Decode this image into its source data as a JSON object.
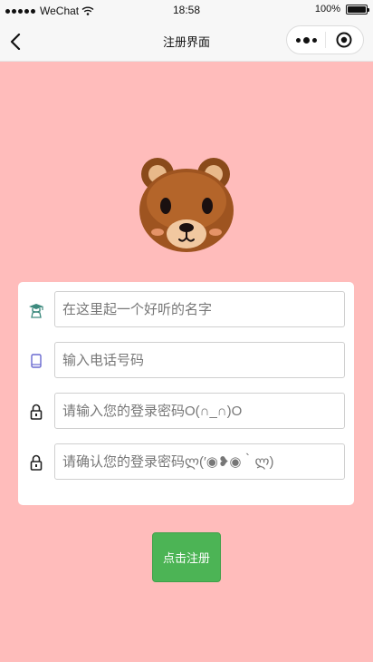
{
  "status_bar": {
    "carrier": "WeChat",
    "time": "18:58",
    "battery_text": "100%",
    "battery_level": 1.0
  },
  "nav": {
    "title": "注册界面",
    "back_icon": "chevron-left-icon",
    "more_icon": "more-dots-icon",
    "close_icon": "target-circle-icon"
  },
  "logo": {
    "icon": "bear-face-icon"
  },
  "form": {
    "fields": [
      {
        "icon": "graduation-cap-icon",
        "placeholder": "在这里起一个好听的名字"
      },
      {
        "icon": "phone-icon",
        "placeholder": "输入电话号码"
      },
      {
        "icon": "lock-icon",
        "placeholder": "请输入您的登录密码O(∩_∩)O"
      },
      {
        "icon": "lock-icon",
        "placeholder": "请确认您的登录密码ლ(′◉❥◉｀ლ)"
      }
    ]
  },
  "register_button": {
    "label": "点击注册"
  },
  "colors": {
    "background": "#ffbcbb",
    "button": "#4cb455",
    "bar": "#f7f7f7"
  }
}
